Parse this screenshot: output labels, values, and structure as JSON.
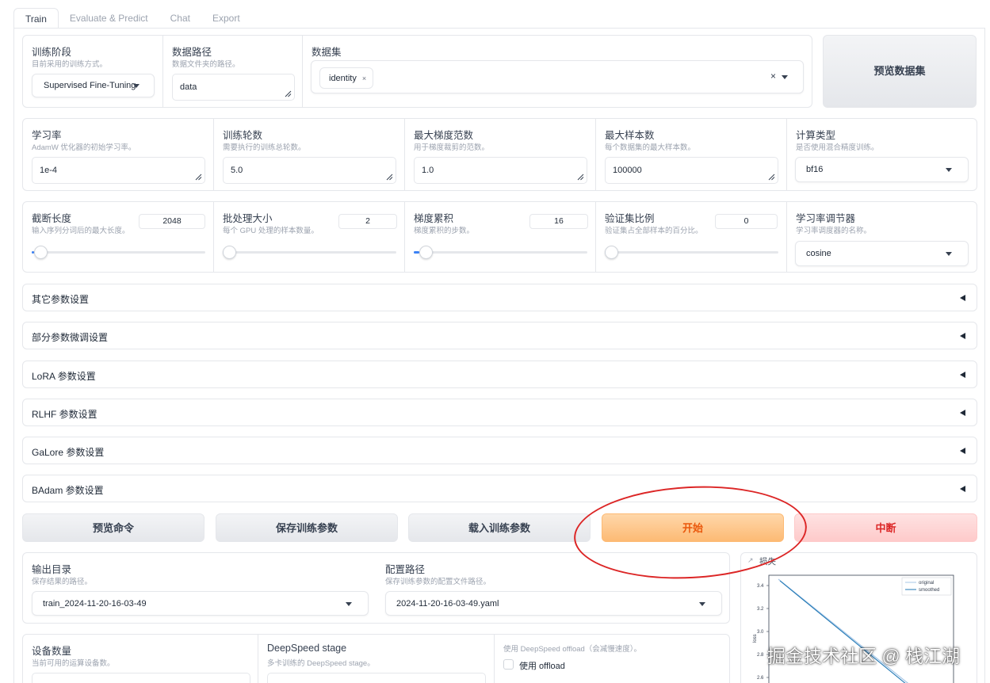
{
  "tabs": [
    "Train",
    "Evaluate & Predict",
    "Chat",
    "Export"
  ],
  "row1": {
    "stage": {
      "label": "训练阶段",
      "desc": "目前采用的训练方式。",
      "value": "Supervised Fine-Tuning"
    },
    "data_path": {
      "label": "数据路径",
      "desc": "数据文件夹的路径。",
      "value": "data"
    },
    "dataset": {
      "label": "数据集",
      "chip": "identity",
      "chip_close": "×",
      "clear": "×"
    },
    "preview_button": "预览数据集"
  },
  "row2": [
    {
      "label": "学习率",
      "desc": "AdamW 优化器的初始学习率。",
      "value": "1e-4"
    },
    {
      "label": "训练轮数",
      "desc": "需要执行的训练总轮数。",
      "value": "5.0"
    },
    {
      "label": "最大梯度范数",
      "desc": "用于梯度裁剪的范数。",
      "value": "1.0"
    },
    {
      "label": "最大样本数",
      "desc": "每个数据集的最大样本数。",
      "value": "100000"
    },
    {
      "label": "计算类型",
      "desc": "是否使用混合精度训练。",
      "value": "bf16"
    }
  ],
  "row3": [
    {
      "label": "截断长度",
      "desc": "输入序列分词后的最大长度。",
      "value": "2048",
      "fraction": 0.015
    },
    {
      "label": "批处理大小",
      "desc": "每个 GPU 处理的样本数量。",
      "value": "2",
      "fraction": 0.0
    },
    {
      "label": "梯度累积",
      "desc": "梯度累积的步数。",
      "value": "16",
      "fraction": 0.03
    },
    {
      "label": "验证集比例",
      "desc": "验证集占全部样本的百分比。",
      "value": "0",
      "fraction": 0.0
    },
    {
      "label": "学习率调节器",
      "desc": "学习率调度器的名称。",
      "value": "cosine"
    }
  ],
  "accordions": [
    "其它参数设置",
    "部分参数微调设置",
    "LoRA 参数设置",
    "RLHF 参数设置",
    "GaLore 参数设置",
    "BAdam 参数设置"
  ],
  "buttons": {
    "preview_cmd": "预览命令",
    "save_args": "保存训练参数",
    "load_args": "载入训练参数",
    "start": "开始",
    "abort": "中断"
  },
  "output": {
    "output_dir": {
      "label": "输出目录",
      "desc": "保存结果的路径。",
      "value": "train_2024-11-20-16-03-49"
    },
    "config_path": {
      "label": "配置路径",
      "desc": "保存训练参数的配置文件路径。",
      "value": "2024-11-20-16-03-49.yaml"
    }
  },
  "device": {
    "device_count": {
      "label": "设备数量",
      "desc": "当前可用的运算设备数。"
    },
    "ds_stage": {
      "label": "DeepSpeed stage",
      "desc": "多卡训练的 DeepSpeed stage。"
    },
    "ds_offload": {
      "desc": "使用 DeepSpeed offload（会减慢速度）。",
      "checkbox_label": "使用 offload"
    }
  },
  "plot": {
    "label": "损失",
    "chart_data": {
      "type": "line",
      "ylabel": "loss",
      "yticks": [
        "3.4",
        "3.2",
        "3.0",
        "2.8",
        "2.6"
      ],
      "series": [
        {
          "name": "original",
          "color": "#a7c7e7"
        },
        {
          "name": "smoothed",
          "color": "#1f77b4"
        }
      ]
    }
  },
  "watermark": "掘金技术社区 @ 栈江湖"
}
